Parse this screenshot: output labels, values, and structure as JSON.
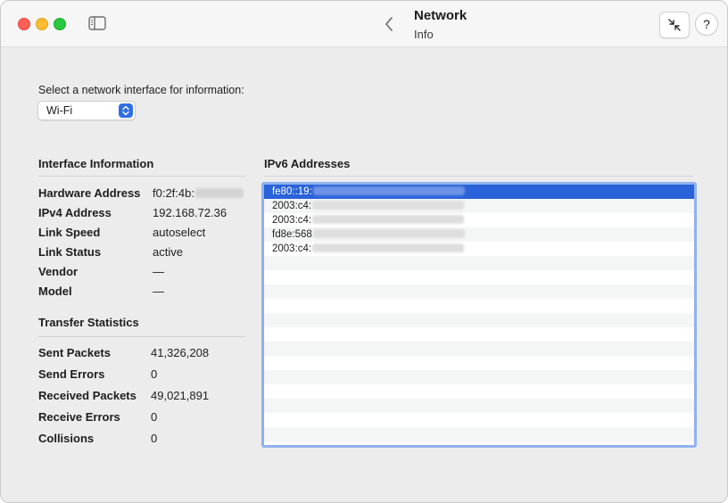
{
  "titlebar": {
    "title": "Network",
    "subtitle": "Info",
    "help_label": "?"
  },
  "interface_select": {
    "prompt": "Select a network interface for information:",
    "value": "Wi-Fi"
  },
  "interface_info": {
    "heading": "Interface Information",
    "rows": [
      {
        "label": "Hardware Address",
        "value": "f0:2f:4b:"
      },
      {
        "label": "IPv4 Address",
        "value": "192.168.72.36"
      },
      {
        "label": "Link Speed",
        "value": "autoselect"
      },
      {
        "label": "Link Status",
        "value": "active"
      },
      {
        "label": "Vendor",
        "value": "—"
      },
      {
        "label": "Model",
        "value": "—"
      }
    ]
  },
  "transfer_stats": {
    "heading": "Transfer Statistics",
    "rows": [
      {
        "label": "Sent Packets",
        "value": "41,326,208"
      },
      {
        "label": "Send Errors",
        "value": "0"
      },
      {
        "label": "Received Packets",
        "value": "49,021,891"
      },
      {
        "label": "Receive Errors",
        "value": "0"
      },
      {
        "label": "Collisions",
        "value": "0"
      }
    ]
  },
  "ipv6": {
    "heading": "IPv6 Addresses",
    "addresses": [
      "fe80::19:",
      "2003:c4:",
      "2003:c4:",
      "fd8e:568",
      "2003:c4:"
    ]
  }
}
